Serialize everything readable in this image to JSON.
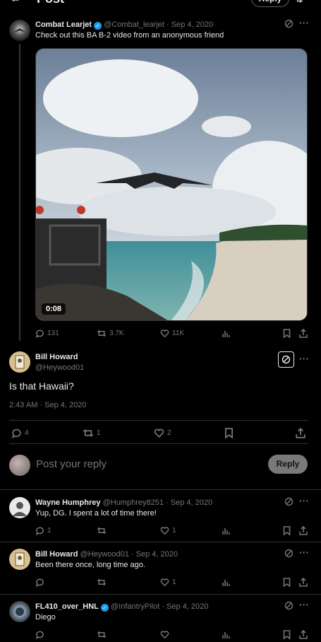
{
  "header": {
    "title": "Post",
    "reply_button": "Reply"
  },
  "tweet1": {
    "name": "Combat Learjet",
    "handle": "@Combat_learjet",
    "date": "Sep 4, 2020",
    "text": "Check out this BA B-2 video from an  anonymous friend",
    "video_duration": "0:08",
    "replies": "131",
    "retweets": "3.7K",
    "likes": "11K"
  },
  "main": {
    "name": "Bill Howard",
    "handle": "@Heywood01",
    "text": "Is that Hawaii?",
    "timestamp": "2:43 AM · Sep 4, 2020",
    "replies": "4",
    "retweets": "1",
    "likes": "2"
  },
  "composer": {
    "placeholder": "Post your reply",
    "button": "Reply"
  },
  "replies": [
    {
      "name": "Wayne Humphrey",
      "handle": "@Humphrey8251",
      "date": "Sep 4, 2020",
      "text": "Yup, DG. I spent a lot of time there!",
      "replies": "1",
      "retweets": "",
      "likes": "1"
    },
    {
      "name": "Bill Howard",
      "handle": "@Heywood01",
      "date": "Sep 4, 2020",
      "text": "Been there once, long time ago.",
      "replies": "",
      "retweets": "",
      "likes": "1"
    },
    {
      "name": "FL410_over_HNL",
      "handle": "@InfantryPilot",
      "date": "Sep 4, 2020",
      "text": "Diego",
      "replies": "",
      "retweets": "",
      "likes": ""
    }
  ],
  "colors": {
    "accent": "#1d9bf0",
    "verified": "#1d9bf0",
    "border": "#2f3336",
    "muted": "#71767b"
  }
}
